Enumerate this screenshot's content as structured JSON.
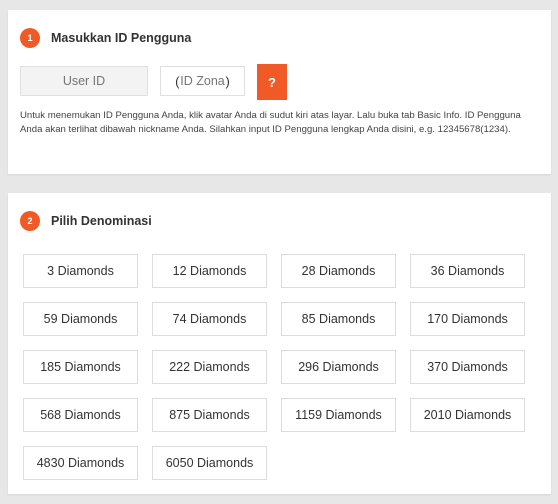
{
  "section_user": {
    "step_number": "1",
    "title": "Masukkan ID Pengguna",
    "user_id_placeholder": "User ID",
    "zone_placeholder": "ID Zona",
    "zone_open_paren": "(",
    "zone_close_paren": ")",
    "help_button_label": "?",
    "help_text": "Untuk menemukan ID Pengguna Anda, klik avatar Anda di sudut kiri atas layar. Lalu buka tab Basic Info. ID Pengguna Anda akan terlihat dibawah nickname Anda. Silahkan input ID Pengguna lengkap Anda disini, e.g. 12345678(1234)."
  },
  "section_denomination": {
    "step_number": "2",
    "title": "Pilih Denominasi",
    "options": [
      "3 Diamonds",
      "12 Diamonds",
      "28 Diamonds",
      "36 Diamonds",
      "59 Diamonds",
      "74 Diamonds",
      "85 Diamonds",
      "170 Diamonds",
      "185 Diamonds",
      "222 Diamonds",
      "296 Diamonds",
      "370 Diamonds",
      "568 Diamonds",
      "875 Diamonds",
      "1159 Diamonds",
      "2010 Diamonds",
      "4830 Diamonds",
      "6050 Diamonds"
    ]
  },
  "colors": {
    "accent": "#ef5a26",
    "page_background": "#e7e7e7",
    "card_background": "#ffffff",
    "border": "#dcdcdc"
  }
}
